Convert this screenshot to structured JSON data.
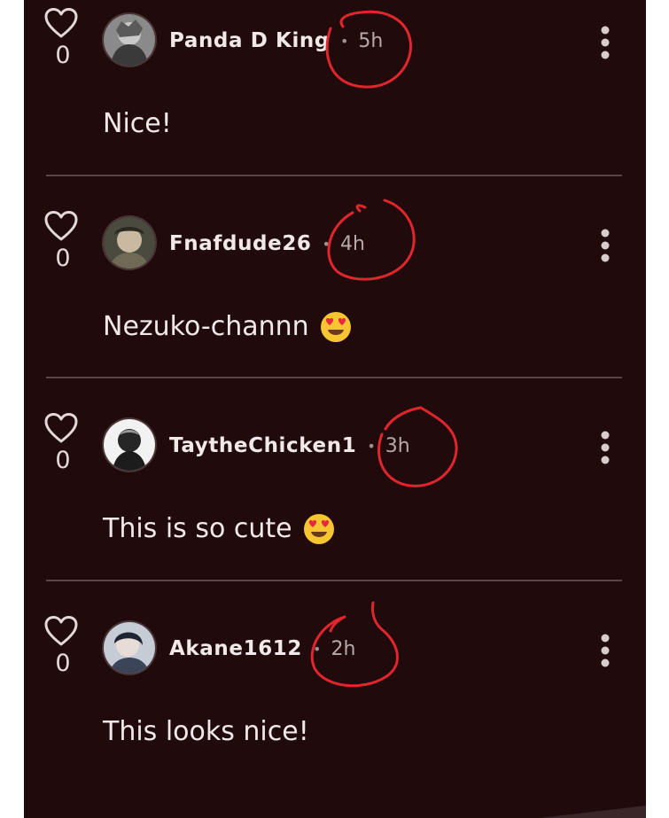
{
  "comments": [
    {
      "username": "Panda D King",
      "separator": "•",
      "time": "5h",
      "likes": "0",
      "text": "Nice!",
      "emoji": ""
    },
    {
      "username": "Fnafdude26",
      "separator": "•",
      "time": "4h",
      "likes": "0",
      "text": "Nezuko-channn",
      "emoji": "heart-eyes-emoji"
    },
    {
      "username": "TaytheChicken1",
      "separator": "•",
      "time": "3h",
      "likes": "0",
      "text": "This is so cute",
      "emoji": "heart-eyes-emoji"
    },
    {
      "username": "Akane1612",
      "separator": "•",
      "time": "2h",
      "likes": "0",
      "text": "This looks nice!",
      "emoji": ""
    }
  ],
  "icons": {
    "like": "heart-outline-icon",
    "menu": "more-vertical-icon",
    "emoji": "heart-eyes-emoji"
  },
  "colors": {
    "background": "#200a0b",
    "text": "#f1e9e9",
    "muted": "#b7a9a9",
    "annotation": "#e0262d"
  }
}
